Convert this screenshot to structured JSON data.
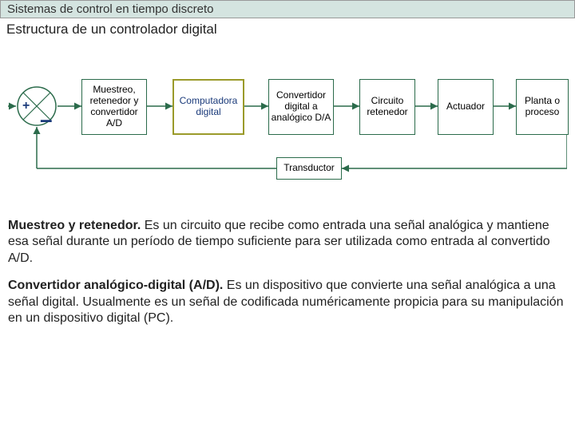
{
  "header": {
    "title": "Sistemas de control en tiempo discreto"
  },
  "subtitle": "Estructura de un controlador digital",
  "blocks": {
    "sum_plus": "+",
    "sum_minus": "–",
    "b1": "Muestreo, retenedor y convertidor A/D",
    "b2": "Computadora digital",
    "b3": "Convertidor digital a analógico D/A",
    "b4": "Circuito retenedor",
    "b5": "Actuador",
    "b6": "Planta o proceso",
    "bT": "Transductor"
  },
  "paragraphs": {
    "p1_term": "Muestreo y retenedor.",
    "p1_body": " Es un circuito que recibe como entrada una señal analógica y mantiene esa señal durante un período de tiempo suficiente para ser utilizada como entrada al convertido A/D.",
    "p2_term": "Convertidor analógico-digital (A/D).",
    "p2_body": " Es un dispositivo que convierte una señal analógica a una señal digital. Usualmente es un señal de codificada numéricamente propicia para su manipulación en un dispositivo digital (PC)."
  }
}
